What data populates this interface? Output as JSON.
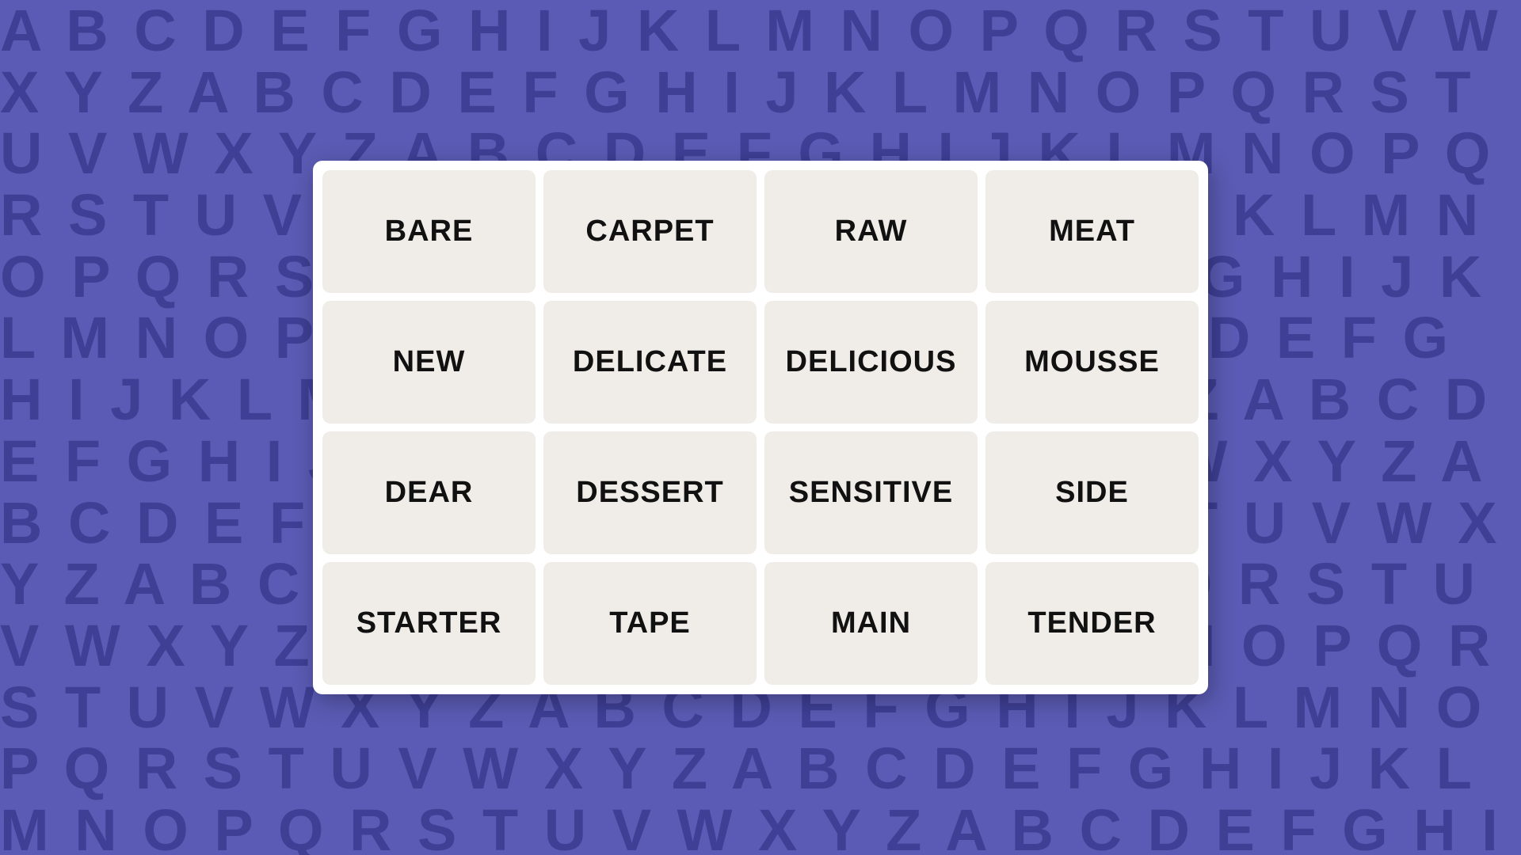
{
  "background": {
    "color": "#5b5bb5",
    "alphabet_pattern": "ABCDEFGHIJKLMNOPQRSTUVWXYZ"
  },
  "grid": {
    "cards": [
      {
        "id": 0,
        "label": "BARE"
      },
      {
        "id": 1,
        "label": "CARPET"
      },
      {
        "id": 2,
        "label": "RAW"
      },
      {
        "id": 3,
        "label": "MEAT"
      },
      {
        "id": 4,
        "label": "NEW"
      },
      {
        "id": 5,
        "label": "DELICATE"
      },
      {
        "id": 6,
        "label": "DELICIOUS"
      },
      {
        "id": 7,
        "label": "MOUSSE"
      },
      {
        "id": 8,
        "label": "DEAR"
      },
      {
        "id": 9,
        "label": "DESSERT"
      },
      {
        "id": 10,
        "label": "SENSITIVE"
      },
      {
        "id": 11,
        "label": "SIDE"
      },
      {
        "id": 12,
        "label": "STARTER"
      },
      {
        "id": 13,
        "label": "TAPE"
      },
      {
        "id": 14,
        "label": "MAIN"
      },
      {
        "id": 15,
        "label": "TENDER"
      }
    ]
  }
}
